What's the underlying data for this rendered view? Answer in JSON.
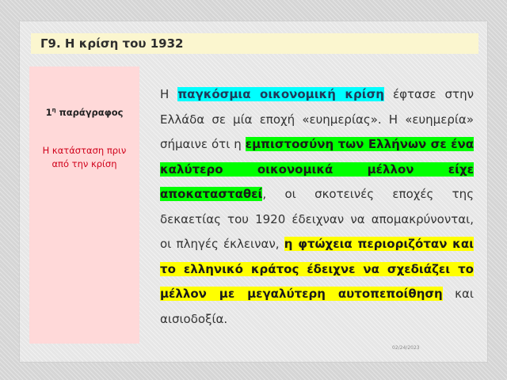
{
  "slide": {
    "title": "Γ9. Η κρίση του 1932",
    "side": {
      "paragraph_number": "1",
      "paragraph_suffix": "η",
      "paragraph_word": " παράγραφος",
      "section_heading": "Η κατάσταση πριν από την κρίση"
    },
    "text": {
      "s1": "Η ",
      "h1": "παγκόσμια οικονομική κρίση",
      "s2": " έφτασε στην Ελλάδα σε μία εποχή «ευημερίας». Η «ευημερία» σήμαινε ότι η ",
      "h2": "εμπιστοσύνη των Ελλήνων σε ένα καλύτερο οικονομικά μέλλον είχε αποκατασταθεί",
      "s3": ", οι σκοτεινές εποχές της δεκαετίας του 1920 έδειχναν να απομακρύνονται, οι πληγές έκλειναν, ",
      "h3": "η φτώχεια περιοριζόταν και το ελληνικό κράτος έδειχνε να σχεδιάζει το μέλλον με μεγαλύτερη αυτοπεποίθηση",
      "s4": " και αισιοδοξία."
    },
    "date": "02/24/2023",
    "colors": {
      "title_bg": "#fbf6cf",
      "side_bg": "#ffd9d9",
      "section_heading": "#d0021b",
      "highlight_cyan": "#00ffff",
      "highlight_green": "#00ff00",
      "highlight_yellow": "#ffff00"
    }
  }
}
